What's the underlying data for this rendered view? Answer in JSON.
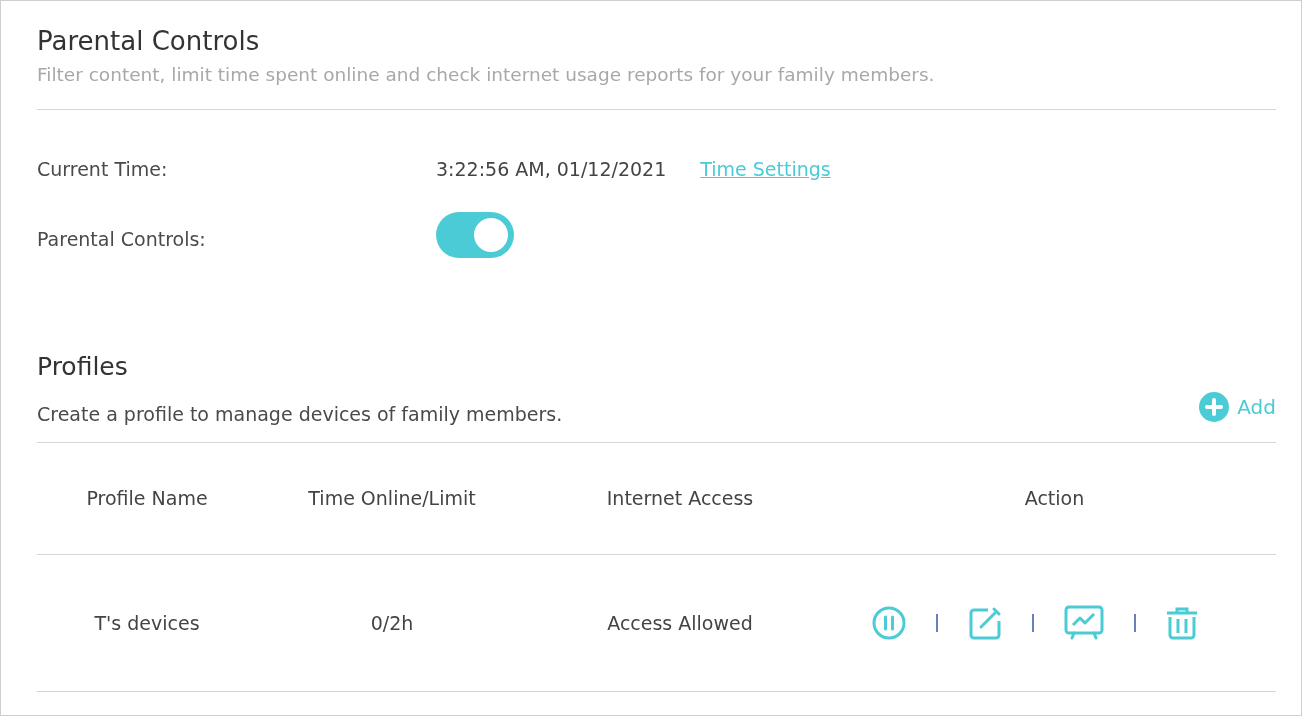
{
  "header": {
    "title": "Parental Controls",
    "description": "Filter content, limit time spent online and check internet usage reports for your family members."
  },
  "settings": {
    "current_time": {
      "label": "Current Time:",
      "value": "3:22:56 AM, 01/12/2021",
      "link": "Time Settings"
    },
    "parental_controls": {
      "label": "Parental Controls:",
      "on": true
    }
  },
  "profiles": {
    "title": "Profiles",
    "description": "Create a profile to manage devices of family members.",
    "add_label": "Add",
    "table": {
      "columns": [
        "Profile Name",
        "Time Online/Limit",
        "Internet Access",
        "Action"
      ],
      "rows": [
        {
          "profile_name": "T's devices",
          "time_online_limit": "0/2h",
          "internet_access": "Access Allowed",
          "actions": [
            {
              "kind": "pause"
            },
            {
              "kind": "edit"
            },
            {
              "kind": "report"
            },
            {
              "kind": "delete"
            }
          ]
        }
      ]
    }
  }
}
